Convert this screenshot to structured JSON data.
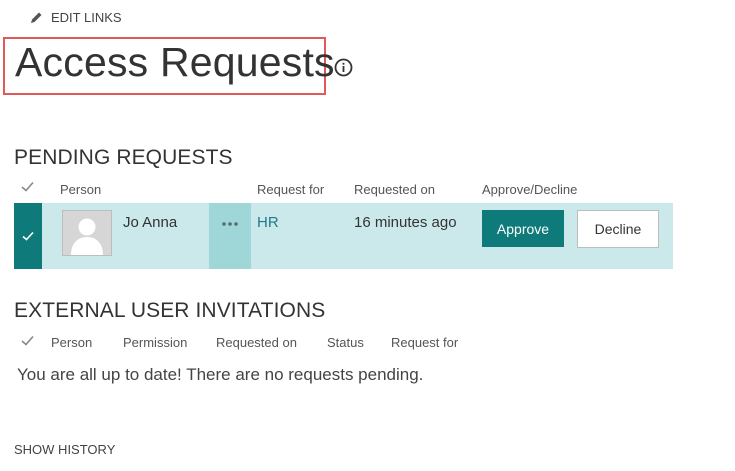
{
  "header": {
    "edit_links_label": "EDIT LINKS",
    "page_title": "Access Requests"
  },
  "pending": {
    "heading": "PENDING REQUESTS",
    "columns": {
      "person": "Person",
      "request_for": "Request for",
      "requested_on": "Requested on",
      "approve_decline": "Approve/Decline"
    },
    "rows": [
      {
        "person": "Jo Anna",
        "request_for": "HR",
        "requested_on": "16 minutes ago",
        "approve_label": "Approve",
        "decline_label": "Decline",
        "selected": true
      }
    ]
  },
  "external": {
    "heading": "EXTERNAL USER INVITATIONS",
    "columns": {
      "person": "Person",
      "permission": "Permission",
      "requested_on": "Requested on",
      "status": "Status",
      "request_for": "Request for"
    },
    "empty_message": "You are all up to date! There are no requests pending."
  },
  "footer": {
    "show_history_label": "SHOW HISTORY"
  },
  "colors": {
    "accent_teal": "#0e7b7a",
    "row_highlight": "#cbe9ea",
    "title_highlight_border": "#e05a5a",
    "link": "#1f7a8c"
  },
  "icons": [
    "pencil-icon",
    "info-icon",
    "checkmark-icon",
    "avatar-placeholder-icon",
    "ellipsis-icon"
  ]
}
